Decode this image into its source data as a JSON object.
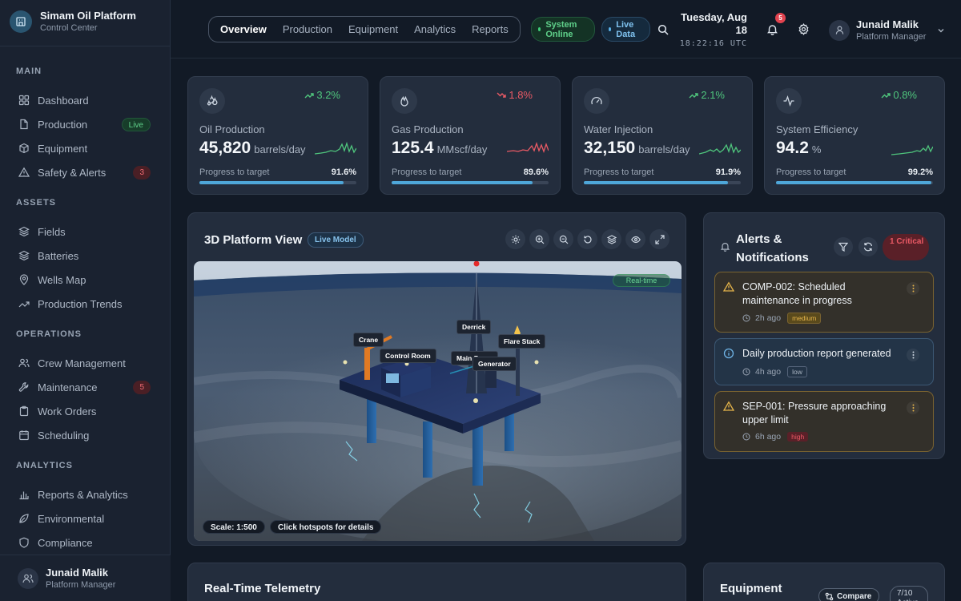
{
  "brand": {
    "title": "Simam Oil Platform",
    "subtitle": "Control Center"
  },
  "sidebar": {
    "sections": [
      {
        "title": "MAIN",
        "items": [
          {
            "label": "Dashboard",
            "icon": "dashboard-icon"
          },
          {
            "label": "Production",
            "icon": "file-icon",
            "badge": "Live"
          },
          {
            "label": "Equipment",
            "icon": "box-icon"
          },
          {
            "label": "Safety & Alerts",
            "icon": "warning-icon",
            "badge": "3"
          }
        ]
      },
      {
        "title": "ASSETS",
        "items": [
          {
            "label": "Fields",
            "icon": "layers-icon"
          },
          {
            "label": "Batteries",
            "icon": "battery-icon"
          },
          {
            "label": "Wells Map",
            "icon": "map-pin-icon"
          },
          {
            "label": "Production Trends",
            "icon": "trend-icon"
          }
        ]
      },
      {
        "title": "OPERATIONS",
        "items": [
          {
            "label": "Crew Management",
            "icon": "users-icon"
          },
          {
            "label": "Maintenance",
            "icon": "wrench-icon",
            "badge": "5"
          },
          {
            "label": "Work Orders",
            "icon": "clipboard-icon"
          },
          {
            "label": "Scheduling",
            "icon": "calendar-icon"
          }
        ]
      },
      {
        "title": "ANALYTICS",
        "items": [
          {
            "label": "Reports & Analytics",
            "icon": "chart-icon"
          },
          {
            "label": "Environmental",
            "icon": "leaf-icon"
          },
          {
            "label": "Compliance",
            "icon": "shield-icon"
          }
        ]
      }
    ],
    "user": {
      "name": "Junaid Malik",
      "role": "Platform Manager"
    }
  },
  "header": {
    "tabs": [
      "Overview",
      "Production",
      "Equipment",
      "Analytics",
      "Reports"
    ],
    "active_tab": "Overview",
    "status_online": "System Online",
    "live_data": "Live Data",
    "date": "Tuesday, Aug 18",
    "time": "18:22:16 UTC",
    "notification_count": "5",
    "user": {
      "name": "Junaid Malik",
      "role": "Platform Manager"
    }
  },
  "kpis": [
    {
      "label": "Oil Production",
      "value": "45,820",
      "unit": "barrels/day",
      "change": "3.2%",
      "direction": "up",
      "progress_label": "Progress to target",
      "progress": "91.6%",
      "progress_frac": 0.916,
      "icon": "droplets-icon",
      "spark_color": "#4fc67d"
    },
    {
      "label": "Gas Production",
      "value": "125.4",
      "unit": "MMscf/day",
      "change": "1.8%",
      "direction": "down",
      "progress_label": "Progress to target",
      "progress": "89.6%",
      "progress_frac": 0.896,
      "icon": "flame-icon",
      "spark_color": "#e95a65"
    },
    {
      "label": "Water Injection",
      "value": "32,150",
      "unit": "barrels/day",
      "change": "2.1%",
      "direction": "up",
      "progress_label": "Progress to target",
      "progress": "91.9%",
      "progress_frac": 0.919,
      "icon": "gauge-icon",
      "spark_color": "#4fc67d"
    },
    {
      "label": "System Efficiency",
      "value": "94.2",
      "unit": "%",
      "change": "0.8%",
      "direction": "up",
      "progress_label": "Progress to target",
      "progress": "99.2%",
      "progress_frac": 0.992,
      "icon": "activity-icon",
      "spark_color": "#4fc67d"
    }
  ],
  "platform_view": {
    "title": "3D Platform View",
    "tag": "Live Model",
    "realtime": "Real-time",
    "hotspots": [
      "Derrick",
      "Crane",
      "Flare Stack",
      "Control Room",
      "Main Pump",
      "Generator"
    ],
    "scale": "Scale: 1:500",
    "hint": "Click hotspots for details"
  },
  "alerts": {
    "title": "Alerts & Notifications",
    "critical": "1 Critical",
    "items": [
      {
        "message": "COMP-002: Scheduled maintenance in progress",
        "time": "2h ago",
        "severity": "medium"
      },
      {
        "message": "Daily production report generated",
        "time": "4h ago",
        "severity": "low"
      },
      {
        "message": "SEP-001: Pressure approaching upper limit",
        "time": "6h ago",
        "severity": "high"
      }
    ]
  },
  "telemetry": {
    "title": "Real-Time Telemetry"
  },
  "equipment": {
    "title": "Equipment",
    "compare": "Compare",
    "count": "7/10 Active"
  }
}
